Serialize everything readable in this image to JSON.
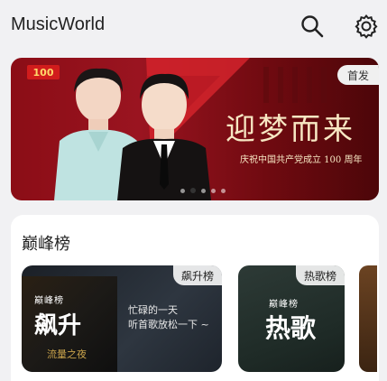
{
  "header": {
    "app_title": "MusicWorld",
    "icons": [
      "search-icon",
      "gear-icon"
    ]
  },
  "banner": {
    "badge": "首发",
    "headline": "迎梦而来",
    "subline": "庆祝中国共产党成立 100 周年",
    "logo_text": "100",
    "dots_count": 5,
    "active_dot": 1,
    "colors": {
      "bg": "#8b0d16",
      "headline": "#f7e7c3"
    }
  },
  "chart_section": {
    "title": "巅峰榜",
    "tiles": [
      {
        "badge": "飙升榜",
        "cover_small": "巅峰榜",
        "cover_big": "飙升",
        "cover_tag": "流量之夜",
        "desc_line1": "忙碌的一天",
        "desc_line2": "听首歌放松一下 ~"
      },
      {
        "badge": "热歌榜",
        "cover_small": "巅峰榜",
        "cover_big": "热歌"
      }
    ]
  }
}
